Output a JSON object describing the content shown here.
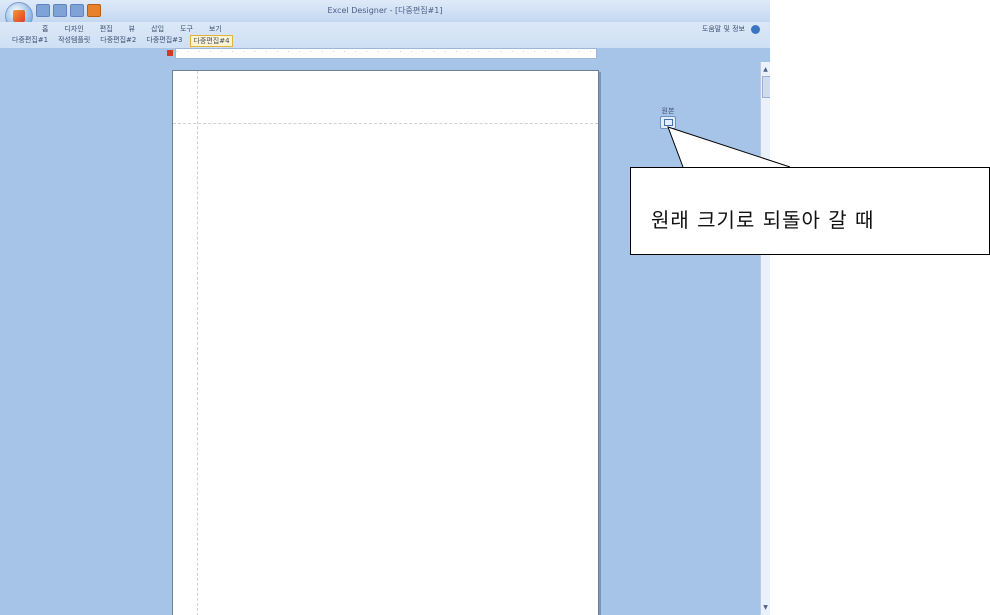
{
  "window": {
    "title": "Excel Designer - [다중편집#1]"
  },
  "menu": {
    "items": [
      "홈",
      "디자인",
      "편집",
      "뷰",
      "삽입",
      "도구",
      "보기"
    ]
  },
  "document_tabs": [
    "다중편집#1",
    "작성템플릿",
    "다중편집#2",
    "다중편집#3",
    "다중편집#4"
  ],
  "toolbar_right": {
    "info": "도움말 및 정보"
  },
  "zoom": {
    "label": "원본"
  },
  "callout": {
    "text": "원래 크기로 되돌아 갈 때"
  },
  "colors": {
    "workspace": "#a6c4e8",
    "page": "#ffffff",
    "accent_orange": "#e8812b",
    "ruler_marker": "#d2391f"
  }
}
